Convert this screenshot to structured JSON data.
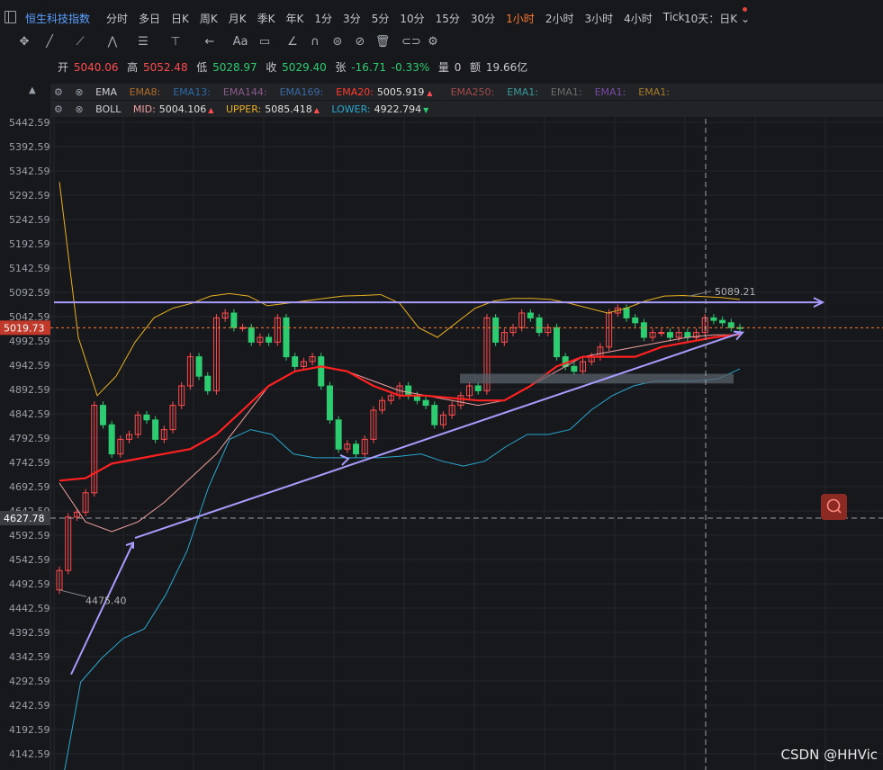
{
  "topbar": {
    "symbol": "恒生科技指数",
    "periods": [
      "分时",
      "多日",
      "日K",
      "周K",
      "月K",
      "季K",
      "年K",
      "1分",
      "3分",
      "5分",
      "10分",
      "15分",
      "30分",
      "1小时",
      "2小时",
      "3小时",
      "4小时",
      "Tick"
    ],
    "active_period": "1小时",
    "range_selector": "10天：日K ⌄"
  },
  "ohlc": {
    "open_label": "开",
    "open": "5040.06",
    "high_label": "高",
    "high": "5052.48",
    "low_label": "低",
    "low": "5028.97",
    "close_label": "收",
    "close": "5029.40",
    "change_label": "张",
    "change": "-16.71",
    "change_pct": "-0.33%",
    "volume_label": "量",
    "volume": "0",
    "amount_label": "额",
    "amount": "19.66亿"
  },
  "ema_row": {
    "name": "EMA",
    "items": [
      {
        "label": "EMA8:",
        "value": "",
        "color": "#b06a2a"
      },
      {
        "label": "EMA13:",
        "value": "",
        "color": "#2a6aa6"
      },
      {
        "label": "EMA144:",
        "value": "",
        "color": "#8a5a8a"
      },
      {
        "label": "EMA169:",
        "value": "",
        "color": "#3a6aa6"
      },
      {
        "label": "EMA20:",
        "value": "5005.919",
        "color": "#ff3b30",
        "arrow": "▲"
      },
      {
        "label": "EMA250:",
        "value": "",
        "color": "#a04a4a"
      },
      {
        "label": "EMA1:",
        "value": "",
        "color": "#3a9a9a"
      },
      {
        "label": "EMA1:",
        "value": "",
        "color": "#6a6a6a"
      },
      {
        "label": "EMA1:",
        "value": "",
        "color": "#7a4aa6"
      },
      {
        "label": "EMA1:",
        "value": "",
        "color": "#a67a2a"
      }
    ]
  },
  "boll_row": {
    "name": "BOLL",
    "mid_label": "MID:",
    "mid": "5004.106",
    "upper_label": "UPPER:",
    "upper": "5085.418",
    "lower_label": "LOWER:",
    "lower": "4922.794"
  },
  "colors": {
    "up": "#ff4d4f",
    "down": "#2ecc71",
    "upper": "#e8b020",
    "lower": "#2aa8d0",
    "mid": "#f0a0a0",
    "ema20": "#ff2020",
    "draw": "#a89cff"
  },
  "chart_data": {
    "type": "candlestick",
    "y_ticks": [
      "5442.59",
      "5392.59",
      "5342.59",
      "5292.59",
      "5242.59",
      "5192.59",
      "5142.59",
      "5092.59",
      "5042.59",
      "4992.59",
      "4942.59",
      "4892.59",
      "4842.59",
      "4792.59",
      "4742.59",
      "4692.59",
      "4642.59",
      "4592.59",
      "4542.59",
      "4492.59",
      "4442.59",
      "4392.59",
      "4342.59",
      "4292.59",
      "4242.59",
      "4192.59",
      "4142.59"
    ],
    "ylim": [
      4112.59,
      5472.59
    ],
    "current_price": "5019.73",
    "crosshair_price": "4627.78",
    "low_annotation": "4475.40",
    "high_annotation": "5089.21",
    "resistance": 5072,
    "zone_price": [
      4905,
      4925
    ]
  },
  "watermark": "CSDN @HHVic"
}
